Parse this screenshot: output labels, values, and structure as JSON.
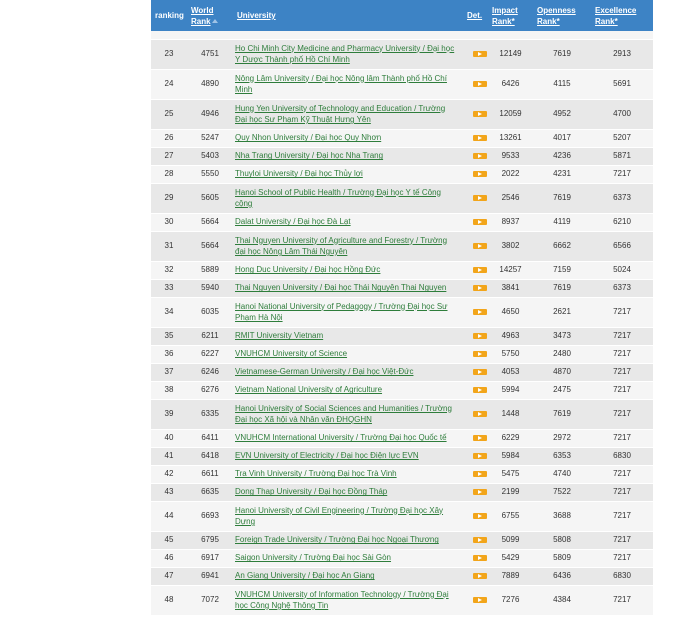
{
  "header": {
    "ranking": "ranking",
    "world_rank": "World Rank",
    "university": "University",
    "det": "Det.",
    "impact": "Impact Rank*",
    "openness": "Openness Rank*",
    "excellence": "Excellence Rank*"
  },
  "colors": {
    "header_bg": "#3d83c5",
    "link": "#2e7d3b",
    "det_icon": "#f2a51a"
  },
  "rows": [
    {
      "rank": "23",
      "world": "4751",
      "name": "Ho Chi Minh City Medicine and Pharmacy University / Đại học Y Dược Thành phố Hồ Chí Minh",
      "impact": "12149",
      "openness": "7619",
      "excellence": "2913",
      "tall": true
    },
    {
      "rank": "24",
      "world": "4890",
      "name": "Nông Lâm University / Đại học Nông lâm Thành phố Hồ Chí Minh",
      "impact": "6426",
      "openness": "4115",
      "excellence": "5691",
      "tall": true
    },
    {
      "rank": "25",
      "world": "4946",
      "name": "Hung Yen University of Technology and Education / Trường Đại học Sư Phạm Kỹ Thuật Hưng Yên",
      "impact": "12059",
      "openness": "4952",
      "excellence": "4700",
      "tall": true
    },
    {
      "rank": "26",
      "world": "5247",
      "name": "Quy Nhon University / Đại học Quy Nhơn",
      "impact": "13261",
      "openness": "4017",
      "excellence": "5207",
      "tall": false
    },
    {
      "rank": "27",
      "world": "5403",
      "name": "Nha Trang University / Đại học Nha Trang",
      "impact": "9533",
      "openness": "4236",
      "excellence": "5871",
      "tall": false
    },
    {
      "rank": "28",
      "world": "5550",
      "name": "Thuyloi University / Đại học Thủy lợi",
      "impact": "2022",
      "openness": "4231",
      "excellence": "7217",
      "tall": false
    },
    {
      "rank": "29",
      "world": "5605",
      "name": "Hanoi School of Public Health / Trường Đại học Y tế Công cộng",
      "impact": "2546",
      "openness": "7619",
      "excellence": "6373",
      "tall": true
    },
    {
      "rank": "30",
      "world": "5664",
      "name": "Dalat University / Đại học Đà Lạt",
      "impact": "8937",
      "openness": "4119",
      "excellence": "6210",
      "tall": false
    },
    {
      "rank": "31",
      "world": "5664",
      "name": "Thai Nguyen University of Agriculture and Forestry / Trường đại học Nông Lâm Thái Nguyên",
      "impact": "3802",
      "openness": "6662",
      "excellence": "6566",
      "tall": true
    },
    {
      "rank": "32",
      "world": "5889",
      "name": "Hong Duc University / Đại học Hồng Đức",
      "impact": "14257",
      "openness": "7159",
      "excellence": "5024",
      "tall": false
    },
    {
      "rank": "33",
      "world": "5940",
      "name": "Thai Nguyen University / Đại học Thái Nguyên Thai Nguyen",
      "impact": "3841",
      "openness": "7619",
      "excellence": "6373",
      "tall": false
    },
    {
      "rank": "34",
      "world": "6035",
      "name": "Hanoi National University of Pedagogy / Trường Đại học Sư Phạm Hà Nội",
      "impact": "4650",
      "openness": "2621",
      "excellence": "7217",
      "tall": true
    },
    {
      "rank": "35",
      "world": "6211",
      "name": "RMIT University Vietnam",
      "impact": "4963",
      "openness": "3473",
      "excellence": "7217",
      "tall": false
    },
    {
      "rank": "36",
      "world": "6227",
      "name": "VNUHCM University of Science",
      "impact": "5750",
      "openness": "2480",
      "excellence": "7217",
      "tall": false
    },
    {
      "rank": "37",
      "world": "6246",
      "name": "Vietnamese-German University / Đại học Việt-Đức",
      "impact": "4053",
      "openness": "4870",
      "excellence": "7217",
      "tall": false
    },
    {
      "rank": "38",
      "world": "6276",
      "name": "Vietnam National University of Agriculture",
      "impact": "5994",
      "openness": "2475",
      "excellence": "7217",
      "tall": false
    },
    {
      "rank": "39",
      "world": "6335",
      "name": "Hanoi University of Social Sciences and Humanities / Trường Đại học Xã hội và Nhân văn ĐHQGHN",
      "impact": "1448",
      "openness": "7619",
      "excellence": "7217",
      "tall": true
    },
    {
      "rank": "40",
      "world": "6411",
      "name": "VNUHCM International University / Trường Đại học Quốc tế",
      "impact": "6229",
      "openness": "2972",
      "excellence": "7217",
      "tall": false
    },
    {
      "rank": "41",
      "world": "6418",
      "name": "EVN University of Electricity / Đại học Điện lực EVN",
      "impact": "5984",
      "openness": "6353",
      "excellence": "6830",
      "tall": false
    },
    {
      "rank": "42",
      "world": "6611",
      "name": "Tra Vinh University / Trường Đại học Trà Vinh",
      "impact": "5475",
      "openness": "4740",
      "excellence": "7217",
      "tall": false
    },
    {
      "rank": "43",
      "world": "6635",
      "name": "Dong Thap University / Đại học Đồng Tháp",
      "impact": "2199",
      "openness": "7522",
      "excellence": "7217",
      "tall": false
    },
    {
      "rank": "44",
      "world": "6693",
      "name": "Hanoi University of Civil Engineering / Trường Đại học Xây Dựng",
      "impact": "6755",
      "openness": "3688",
      "excellence": "7217",
      "tall": true
    },
    {
      "rank": "45",
      "world": "6795",
      "name": "Foreign Trade University / Trường Đại học Ngoại Thương",
      "impact": "5099",
      "openness": "5808",
      "excellence": "7217",
      "tall": false
    },
    {
      "rank": "46",
      "world": "6917",
      "name": "Saigon University / Trường Đại học Sài Gòn",
      "impact": "5429",
      "openness": "5809",
      "excellence": "7217",
      "tall": false
    },
    {
      "rank": "47",
      "world": "6941",
      "name": "An Giang University / Đại học An Giang",
      "impact": "7889",
      "openness": "6436",
      "excellence": "6830",
      "tall": false
    },
    {
      "rank": "48",
      "world": "7072",
      "name": "VNUHCM University of Information Technology / Trường Đại học Công Nghệ Thông Tin",
      "impact": "7276",
      "openness": "4384",
      "excellence": "7217",
      "tall": true
    }
  ]
}
